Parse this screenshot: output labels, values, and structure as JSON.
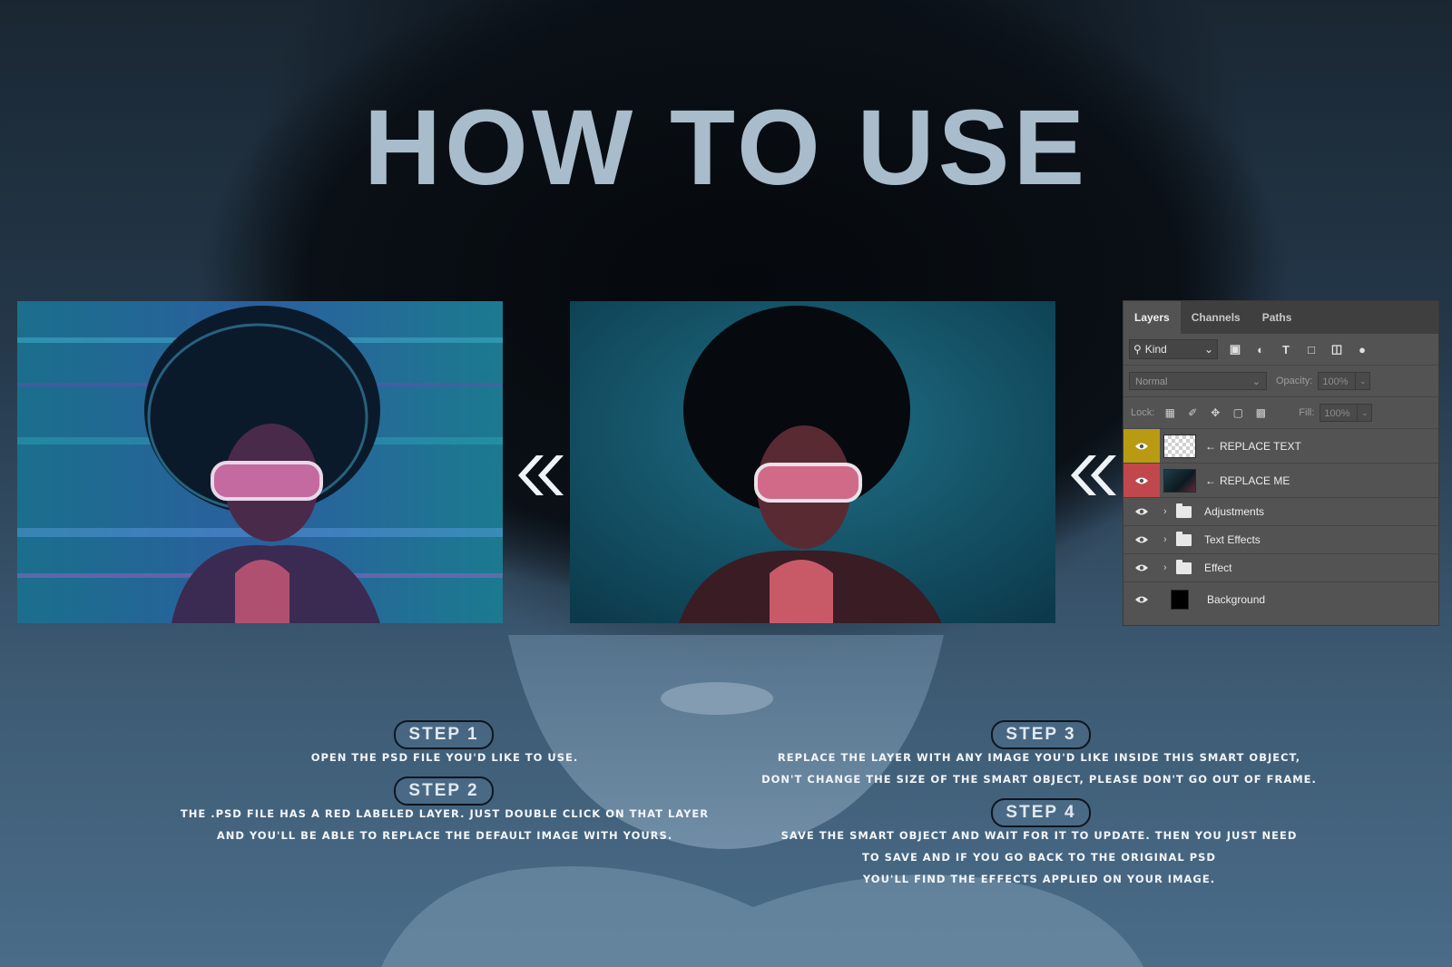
{
  "title": "HOW TO USE",
  "layers_panel": {
    "tabs": [
      "Layers",
      "Channels",
      "Paths"
    ],
    "filter_kind": "Kind",
    "blend_mode": "Normal",
    "opacity_label": "Opacity:",
    "opacity_value": "100%",
    "lock_label": "Lock:",
    "fill_label": "Fill:",
    "fill_value": "100%",
    "layers": [
      {
        "name": "REPLACE TEXT",
        "arrow": "←",
        "label_color": "#b89b12"
      },
      {
        "name": "REPLACE ME",
        "arrow": "←",
        "label_color": "#c0474b"
      },
      {
        "name": "Adjustments"
      },
      {
        "name": "Text Effects"
      },
      {
        "name": "Effect"
      },
      {
        "name": "Background"
      }
    ]
  },
  "steps": [
    {
      "label": "STEP 1",
      "lines": [
        "OPEN THE PSD FILE YOU'D LIKE TO USE."
      ]
    },
    {
      "label": "STEP 2",
      "lines": [
        "THE .PSD FILE HAS A RED LABELED LAYER. JUST DOUBLE CLICK ON THAT LAYER",
        "AND YOU'LL BE ABLE TO REPLACE THE DEFAULT IMAGE WITH YOURS."
      ]
    },
    {
      "label": "STEP 3",
      "lines": [
        "REPLACE THE LAYER WITH ANY IMAGE YOU'D LIKE INSIDE THIS SMART OBJECT,",
        "DON'T CHANGE THE SIZE OF THE SMART OBJECT, PLEASE DON'T GO OUT OF FRAME."
      ]
    },
    {
      "label": "STEP 4",
      "lines": [
        "SAVE THE SMART OBJECT AND WAIT FOR IT TO UPDATE. THEN YOU JUST NEED",
        "TO SAVE AND IF YOU GO BACK TO THE ORIGINAL PSD",
        "YOU'LL FIND THE EFFECTS APPLIED ON YOUR IMAGE."
      ]
    }
  ]
}
